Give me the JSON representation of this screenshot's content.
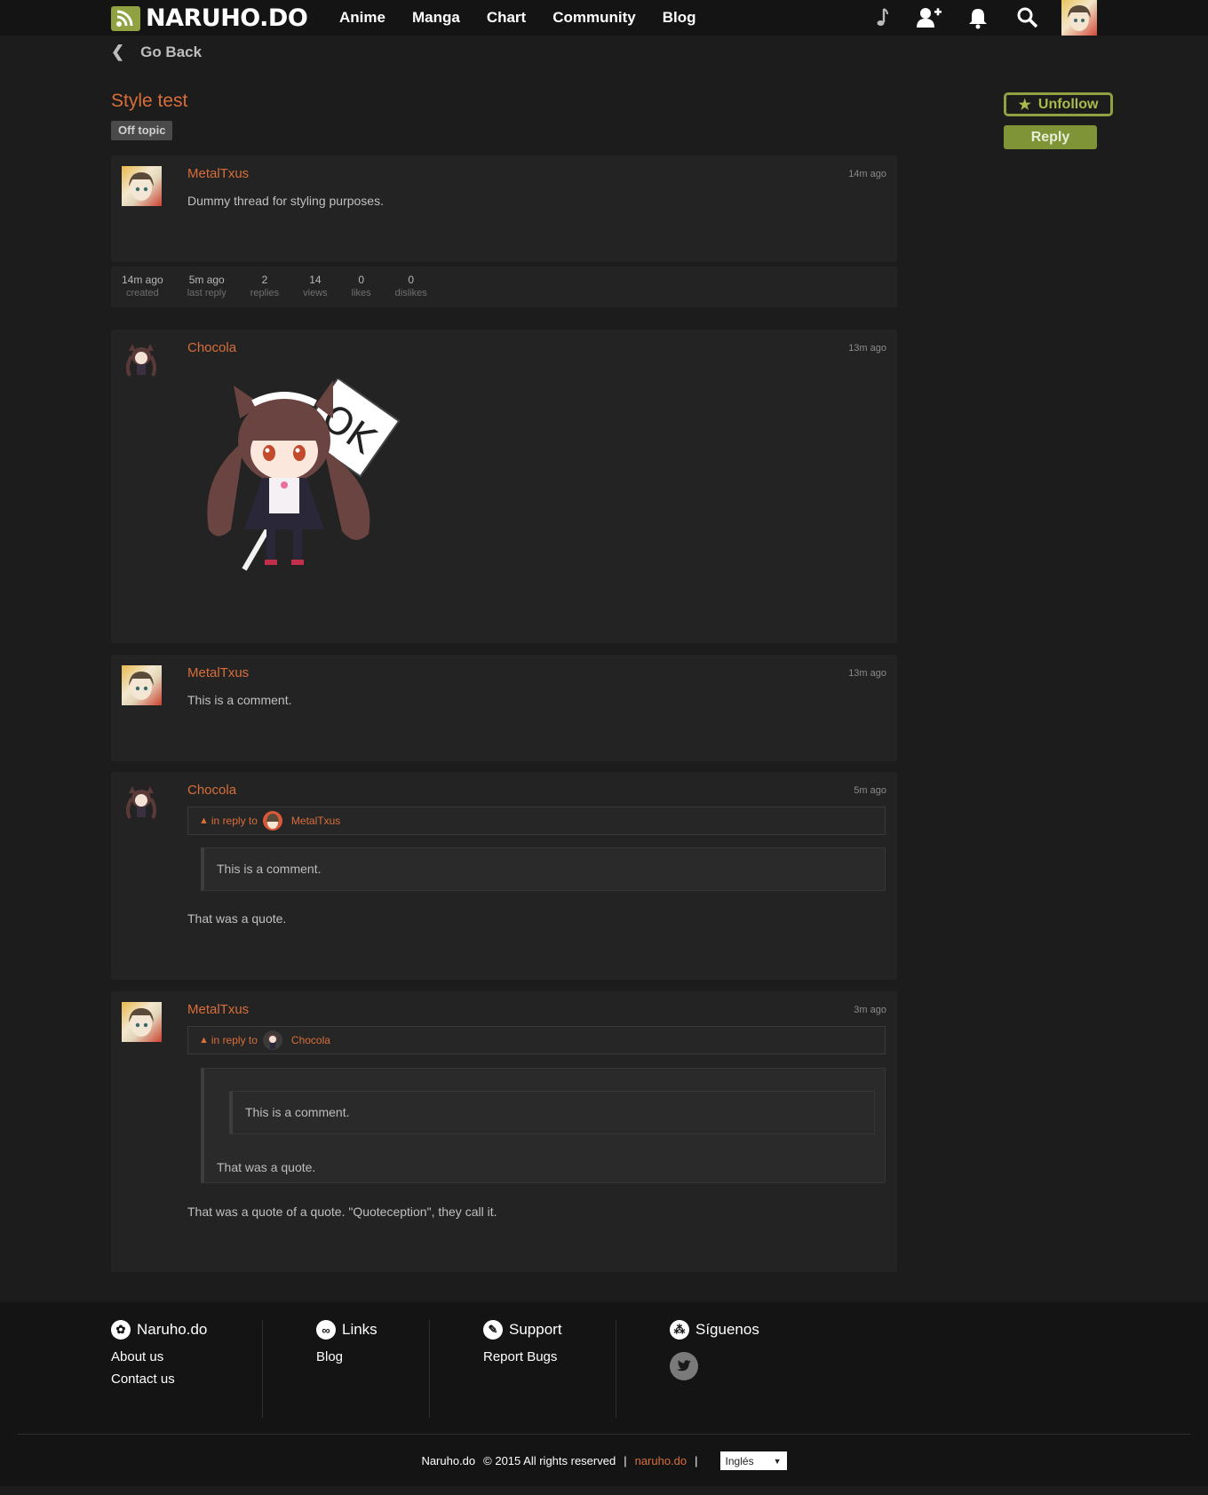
{
  "header": {
    "logo_text": "NARUHO.DO",
    "nav": [
      "Anime",
      "Manga",
      "Chart",
      "Community",
      "Blog"
    ],
    "icons": [
      "music-note-icon",
      "add-user-icon",
      "bell-icon",
      "search-icon"
    ]
  },
  "goback_label": "Go Back",
  "thread": {
    "title": "Style test",
    "tag": "Off topic",
    "unfollow_label": "Unfollow",
    "reply_label": "Reply"
  },
  "colors": {
    "accent": "#d86e3a",
    "green": "#8fa140",
    "bg": "#1c1c1c",
    "panel": "#232323"
  },
  "posts": [
    {
      "author": "MetalTxus",
      "time": "14m ago",
      "text": "Dummy thread for styling purposes."
    },
    {
      "author": "Chocola",
      "time": "13m ago",
      "image_text": "OK"
    },
    {
      "author": "MetalTxus",
      "time": "13m ago",
      "text": "This is a comment."
    },
    {
      "author": "Chocola",
      "time": "5m ago",
      "in_reply_label": "in reply to",
      "reply_to": "MetalTxus",
      "quote": "This is a comment.",
      "text": "That was a quote."
    },
    {
      "author": "MetalTxus",
      "time": "3m ago",
      "in_reply_label": "in reply to",
      "reply_to": "Chocola",
      "inner_quote": "This is a comment.",
      "outer_quote": "That was a quote.",
      "text": "That was a quote of a quote. \"Quoteception\", they call it."
    }
  ],
  "stats": [
    {
      "value": "14m ago",
      "label": "created"
    },
    {
      "value": "5m ago",
      "label": "last reply"
    },
    {
      "value": "2",
      "label": "replies"
    },
    {
      "value": "14",
      "label": "views"
    },
    {
      "value": "0",
      "label": "likes"
    },
    {
      "value": "0",
      "label": "dislikes"
    }
  ],
  "footer": {
    "col1": {
      "title": "Naruho.do",
      "links": [
        "About us",
        "Contact us"
      ]
    },
    "col2": {
      "title": "Links",
      "links": [
        "Blog"
      ]
    },
    "col3": {
      "title": "Support",
      "links": [
        "Report Bugs"
      ]
    },
    "col4": {
      "title": "Síguenos"
    },
    "brand": "Naruho.do",
    "copyright": "© 2015 All rights reserved",
    "site": "naruho.do",
    "language": "Inglés"
  }
}
